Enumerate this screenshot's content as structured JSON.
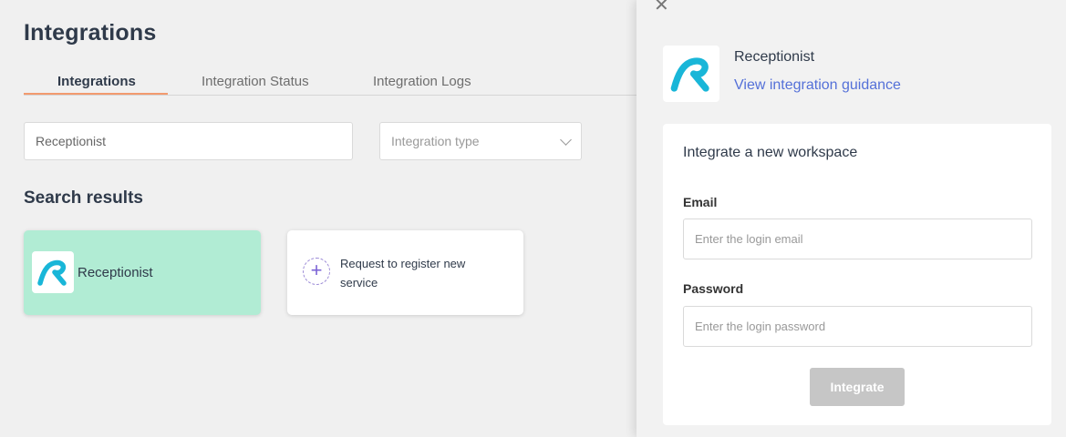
{
  "page": {
    "title": "Integrations",
    "tabs": [
      {
        "label": "Integrations",
        "active": true
      },
      {
        "label": "Integration Status",
        "active": false
      },
      {
        "label": "Integration Logs",
        "active": false
      }
    ],
    "search": {
      "value": "Receptionist"
    },
    "type_select": {
      "placeholder": "Integration type"
    },
    "results_title": "Search results",
    "results": [
      {
        "name": "Receptionist",
        "icon": "receptionist-logo-icon"
      }
    ],
    "request_card": {
      "text": "Request to register new service",
      "icon": "plus-icon"
    }
  },
  "panel": {
    "service_name": "Receptionist",
    "guidance_link": "View integration guidance",
    "form": {
      "title": "Integrate a new workspace",
      "email_label": "Email",
      "email_placeholder": "Enter the login email",
      "password_label": "Password",
      "password_placeholder": "Enter the login password",
      "submit_label": "Integrate"
    }
  },
  "colors": {
    "accent_tab": "#f29a6e",
    "result_card": "#b1ecd4",
    "link": "#5470d8",
    "logo": "#19b6d8"
  }
}
